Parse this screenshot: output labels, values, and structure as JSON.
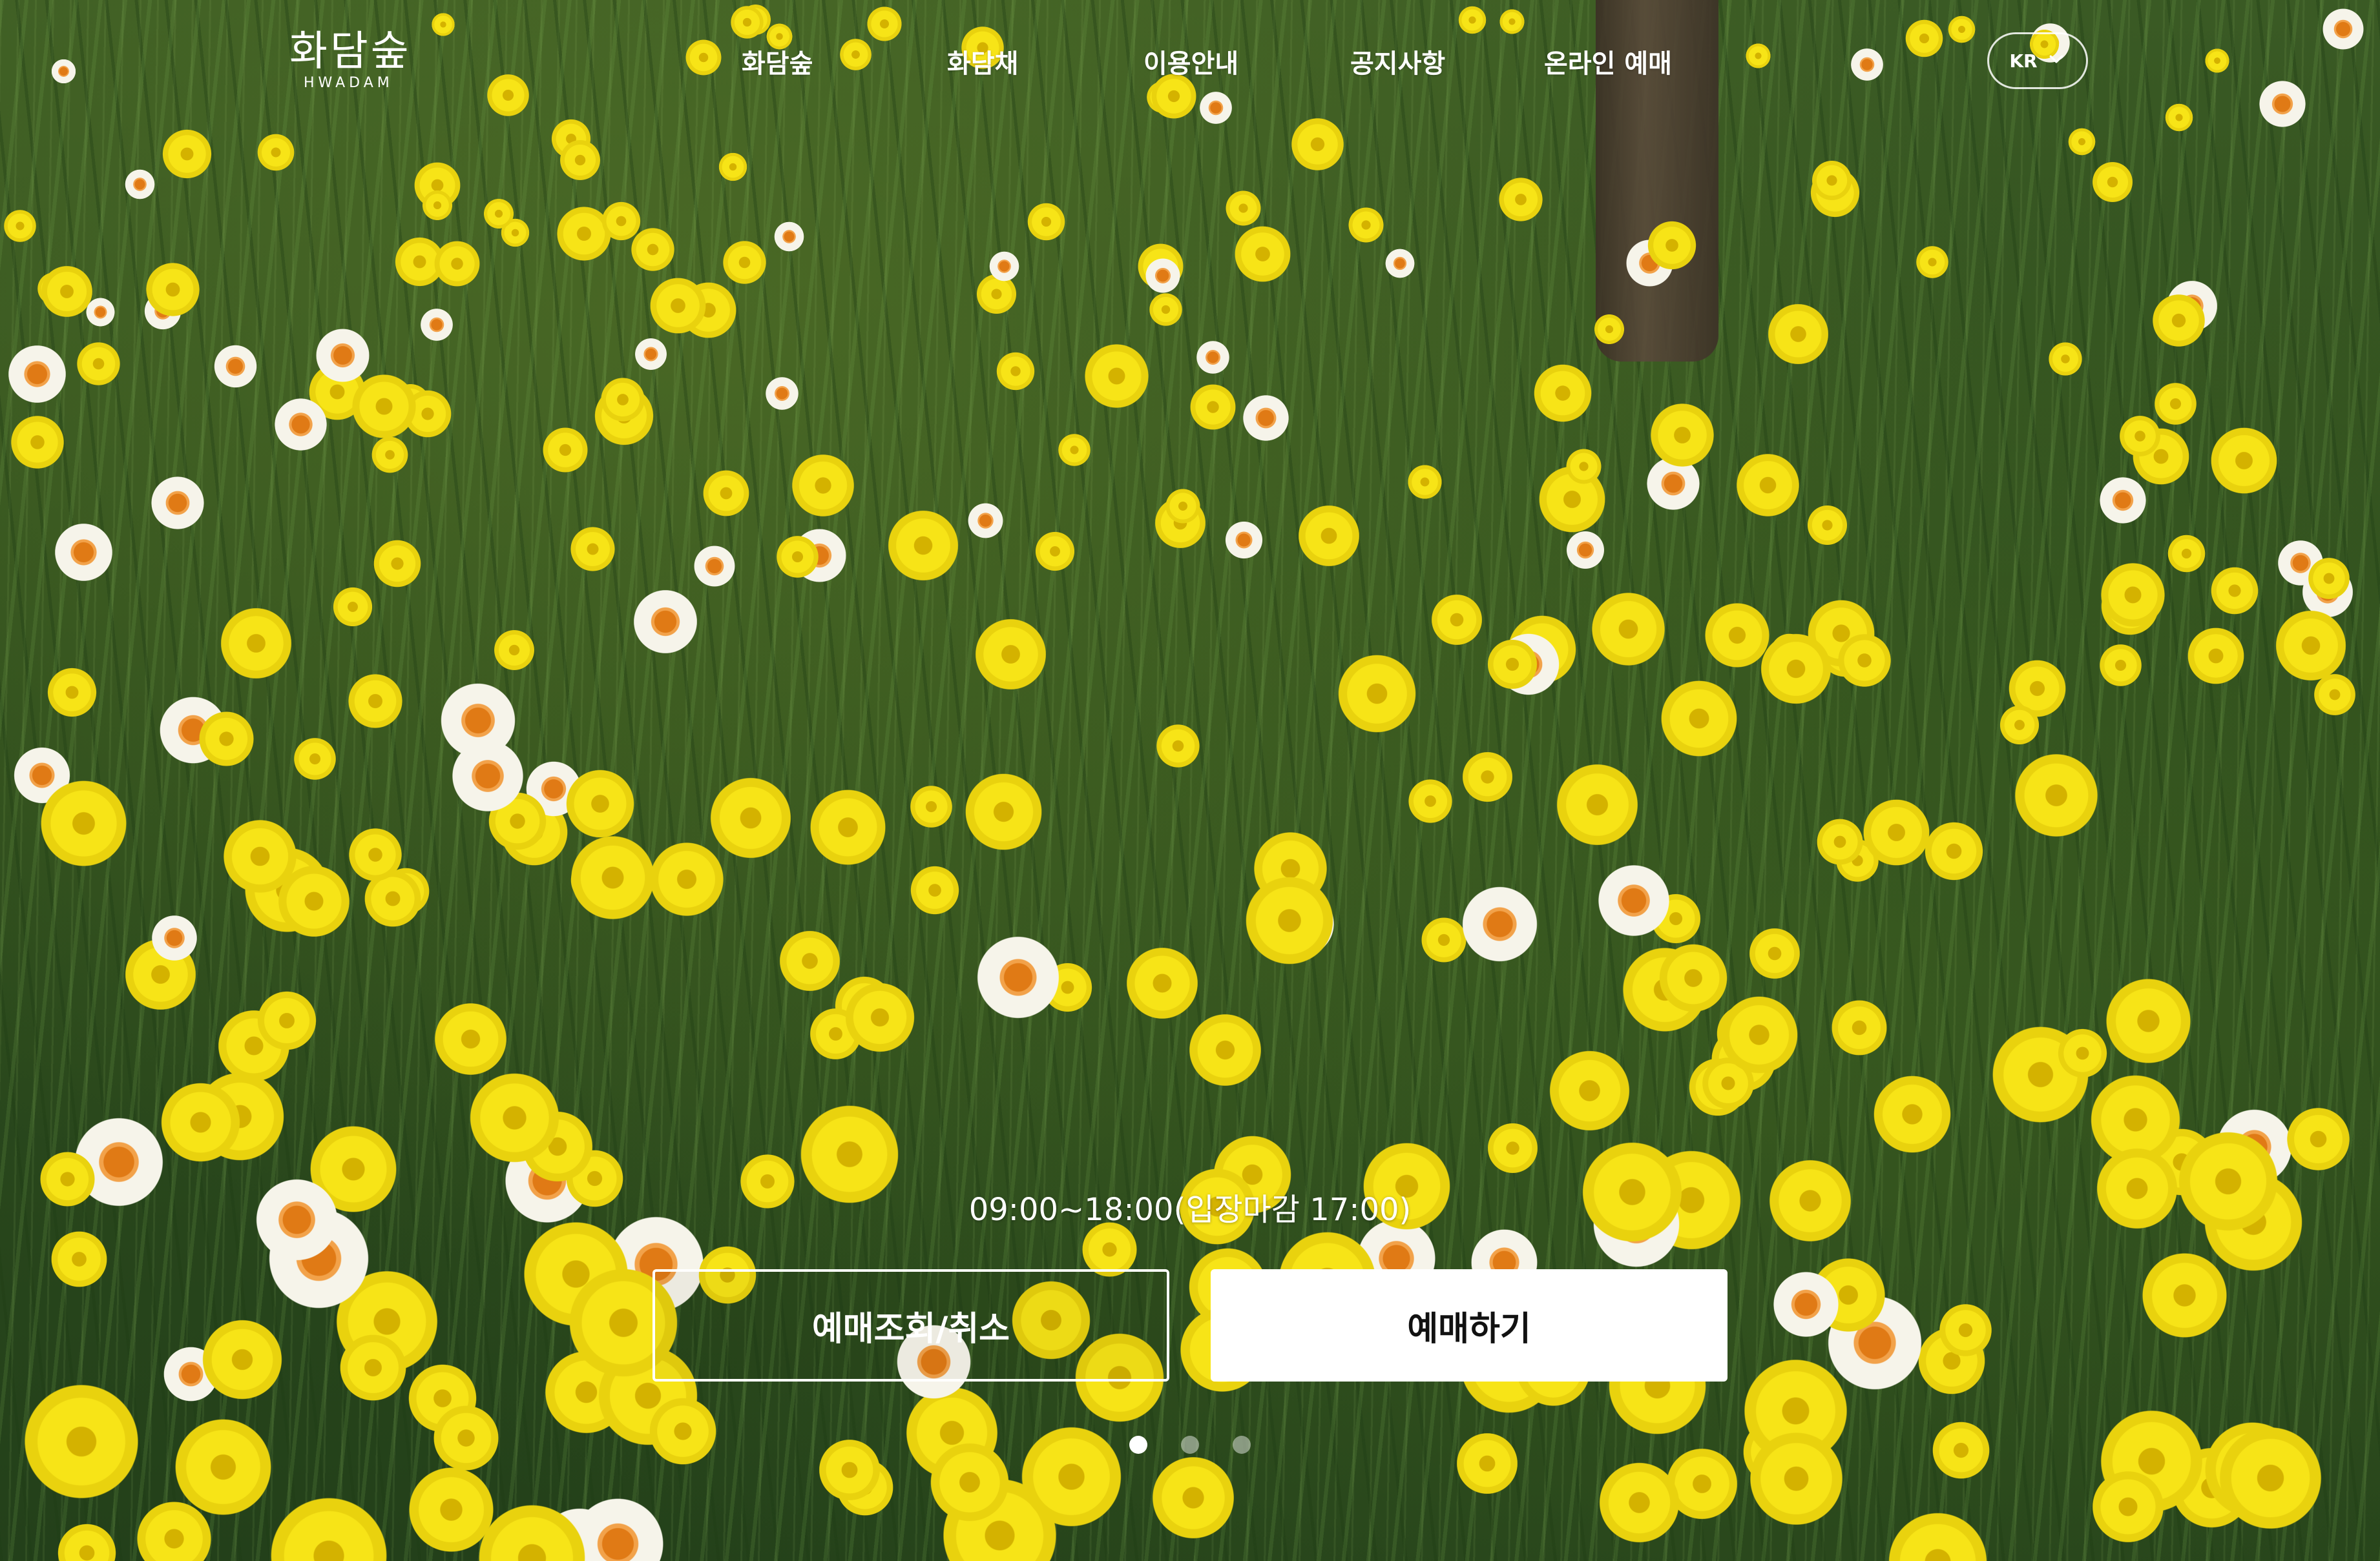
{
  "header": {
    "logo": {
      "name": "화담숲",
      "sub": "HWADAM"
    },
    "nav": [
      {
        "label": "화담숲"
      },
      {
        "label": "화담채"
      },
      {
        "label": "이용안내"
      },
      {
        "label": "공지사항"
      },
      {
        "label": "온라인 예매"
      }
    ],
    "language": {
      "label": "KR",
      "icon": "chevron-down-icon"
    }
  },
  "hero": {
    "background": "daffodil field photo",
    "hours": "09:00~18:00(입장마감 17:00)",
    "buttons": {
      "lookup_cancel": "예매조회/취소",
      "book": "예매하기"
    },
    "slides": {
      "count": 3,
      "active": 1
    }
  },
  "colors": {
    "button_text_dark": "#111111",
    "white": "#ffffff"
  }
}
